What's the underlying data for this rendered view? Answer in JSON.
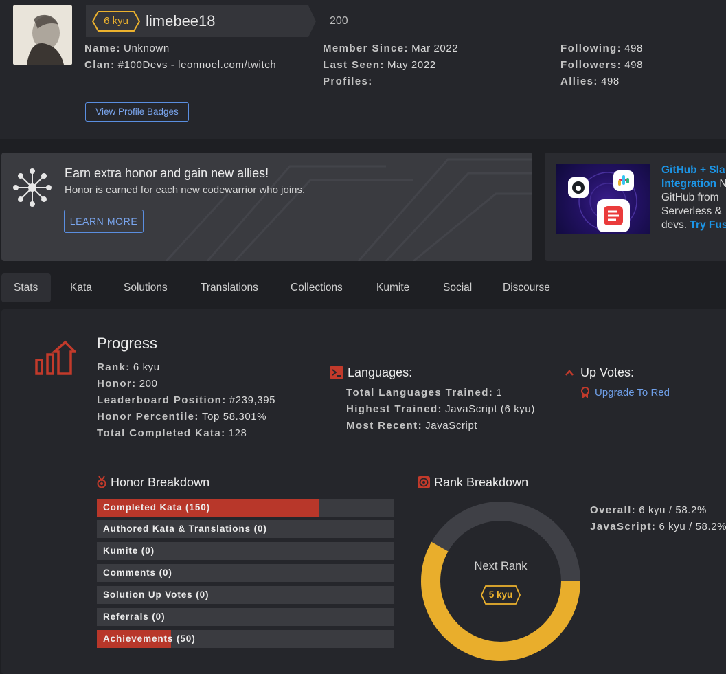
{
  "profile": {
    "rank_badge": "6 kyu",
    "username": "limebee18",
    "honor": "200",
    "name_label": "Name:",
    "name_value": "Unknown",
    "clan_label": "Clan:",
    "clan_value": "#100Devs - leonnoel.com/twitch",
    "member_since_label": "Member Since:",
    "member_since_value": "Mar 2022",
    "last_seen_label": "Last Seen:",
    "last_seen_value": "May 2022",
    "profiles_label": "Profiles:",
    "following_label": "Following:",
    "following_value": "498",
    "followers_label": "Followers:",
    "followers_value": "498",
    "allies_label": "Allies:",
    "allies_value": "498",
    "view_badges_button": "View Profile Badges"
  },
  "promo": {
    "title": "Earn extra honor and gain new allies!",
    "text": "Honor is earned for each new codewarrior who joins.",
    "button": "LEARN MORE"
  },
  "ad": {
    "line1_link": "GitHub + Sla",
    "line2_link": "Integration",
    "line2_rest": " N",
    "line3": "GitHub from",
    "line4": "Serverless &",
    "line5_pre": "devs. ",
    "line5_link": "Try Fus"
  },
  "tabs": [
    "Stats",
    "Kata",
    "Solutions",
    "Translations",
    "Collections",
    "Kumite",
    "Social",
    "Discourse"
  ],
  "progress": {
    "title": "Progress",
    "rank_label": "Rank:",
    "rank_value": "6 kyu",
    "honor_label": "Honor:",
    "honor_value": "200",
    "leaderboard_label": "Leaderboard Position:",
    "leaderboard_value": "#239,395",
    "percentile_label": "Honor Percentile:",
    "percentile_value": "Top 58.301%",
    "completed_label": "Total Completed Kata:",
    "completed_value": "128"
  },
  "languages": {
    "title": "Languages:",
    "total_label": "Total Languages Trained:",
    "total_value": "1",
    "highest_label": "Highest Trained:",
    "highest_value": "JavaScript (6 kyu)",
    "recent_label": "Most Recent:",
    "recent_value": "JavaScript"
  },
  "upvotes": {
    "title": "Up Votes:",
    "link": "Upgrade To Red"
  },
  "honor_breakdown": {
    "title": "Honor Breakdown",
    "items": [
      {
        "label": "Completed Kata (150)",
        "fill_fraction": 0.75
      },
      {
        "label": "Authored Kata & Translations (0)",
        "fill_fraction": 0
      },
      {
        "label": "Kumite (0)",
        "fill_fraction": 0
      },
      {
        "label": "Comments (0)",
        "fill_fraction": 0
      },
      {
        "label": "Solution Up Votes (0)",
        "fill_fraction": 0
      },
      {
        "label": "Referrals (0)",
        "fill_fraction": 0
      },
      {
        "label": "Achievements (50)",
        "fill_fraction": 0.25
      }
    ]
  },
  "rank_breakdown": {
    "title": "Rank Breakdown",
    "next_rank_label": "Next Rank",
    "next_rank_badge": "5 kyu",
    "progress_fraction": 0.582,
    "overall_label": "Overall:",
    "overall_value": "6 kyu / 58.2%",
    "js_label": "JavaScript:",
    "js_value": "6 kyu / 58.2%"
  },
  "colors": {
    "accent_red": "#b8372a",
    "kyu_yellow": "#ecb22e",
    "link_blue": "#7aa6ef"
  }
}
